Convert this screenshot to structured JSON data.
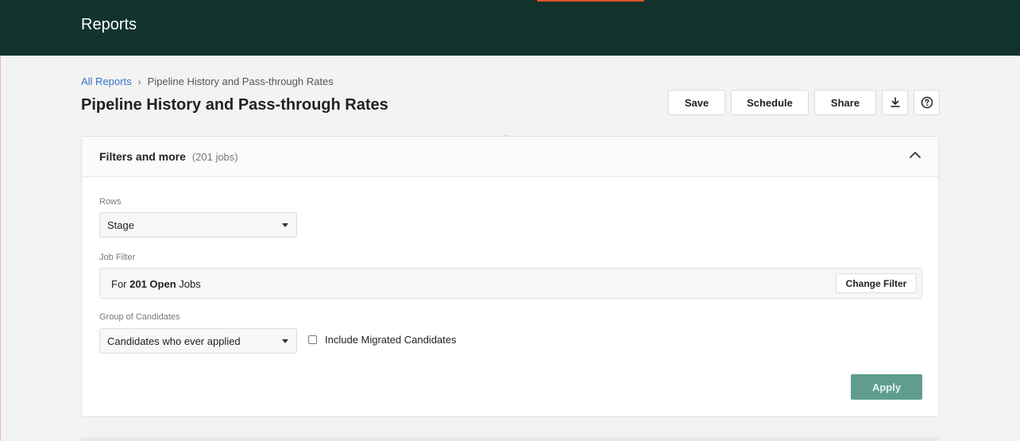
{
  "header": {
    "title": "Reports",
    "accent_color": "#e0522b",
    "bg_color": "#12332c"
  },
  "breadcrumb": {
    "root": "All Reports",
    "current": "Pipeline History and Pass-through Rates"
  },
  "page": {
    "title": "Pipeline History and Pass-through Rates"
  },
  "toolbar": {
    "save_label": "Save",
    "schedule_label": "Schedule",
    "share_label": "Share",
    "download_icon": "download-icon",
    "help_icon": "help-icon"
  },
  "filters": {
    "title": "Filters and more",
    "count": "(201 jobs)",
    "rows_label": "Rows",
    "rows_value": "Stage",
    "job_filter_label": "Job Filter",
    "job_filter_prefix": "For ",
    "job_filter_bold": "201 Open",
    "job_filter_suffix": " Jobs",
    "change_filter_label": "Change Filter",
    "group_label": "Group of Candidates",
    "group_value": "Candidates who ever applied",
    "include_migrated_label": "Include Migrated Candidates",
    "apply_label": "Apply",
    "apply_color": "#5f9e8e"
  }
}
